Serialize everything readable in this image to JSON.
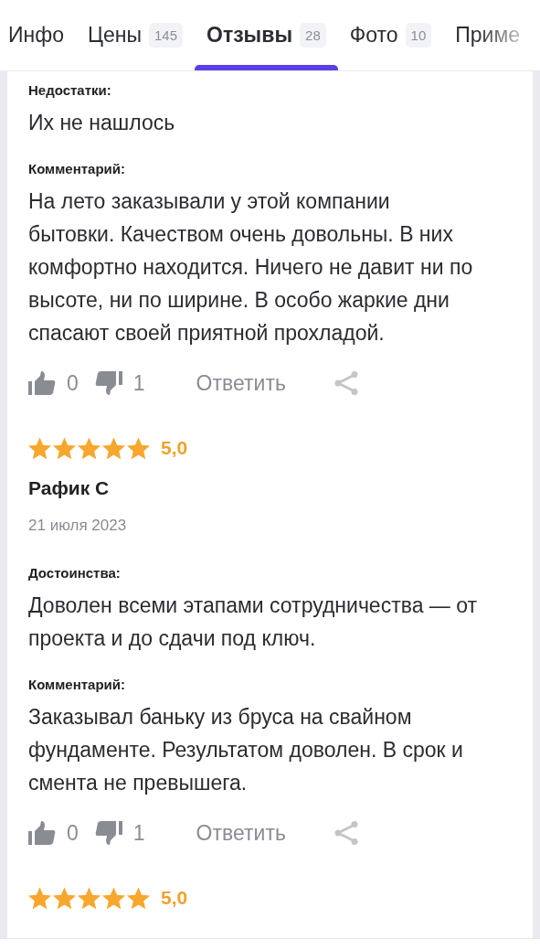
{
  "tabs": [
    {
      "label": "Инфо",
      "selected": false
    },
    {
      "label": "Цены",
      "count": "145",
      "selected": false
    },
    {
      "label": "Отзывы",
      "count": "28",
      "selected": true
    },
    {
      "label": "Фото",
      "count": "10",
      "selected": false
    },
    {
      "label": "Приме",
      "selected": false
    }
  ],
  "reviews": [
    {
      "sections": [
        {
          "label": "Недостатки:",
          "text": "Их не нашлось"
        },
        {
          "label": "Комментарий:",
          "text": "На лето заказывали у этой компании бытовки. Качеством очень довольны. В них комфортно находится. Ничего не давит ни по высоте, ни по ширине. В особо жаркие дни спасают своей приятной прохладой."
        }
      ],
      "likes": "0",
      "dislikes": "1",
      "reply": "Ответить"
    },
    {
      "stars": 5,
      "rating": "5,0",
      "author": "Рафик С",
      "date": "21 июля 2023",
      "sections": [
        {
          "label": "Достоинства:",
          "text": "Доволен всеми этапами сотрудничества — от проекта и до сдачи под ключ."
        },
        {
          "label": "Комментарий:",
          "text": "Заказывал баньку из бруса на свайном фундаменте. Результатом доволен. В срок и смента не превышега."
        }
      ],
      "likes": "0",
      "dislikes": "1",
      "reply": "Ответить"
    },
    {
      "stars": 5,
      "rating": "5,0"
    }
  ]
}
